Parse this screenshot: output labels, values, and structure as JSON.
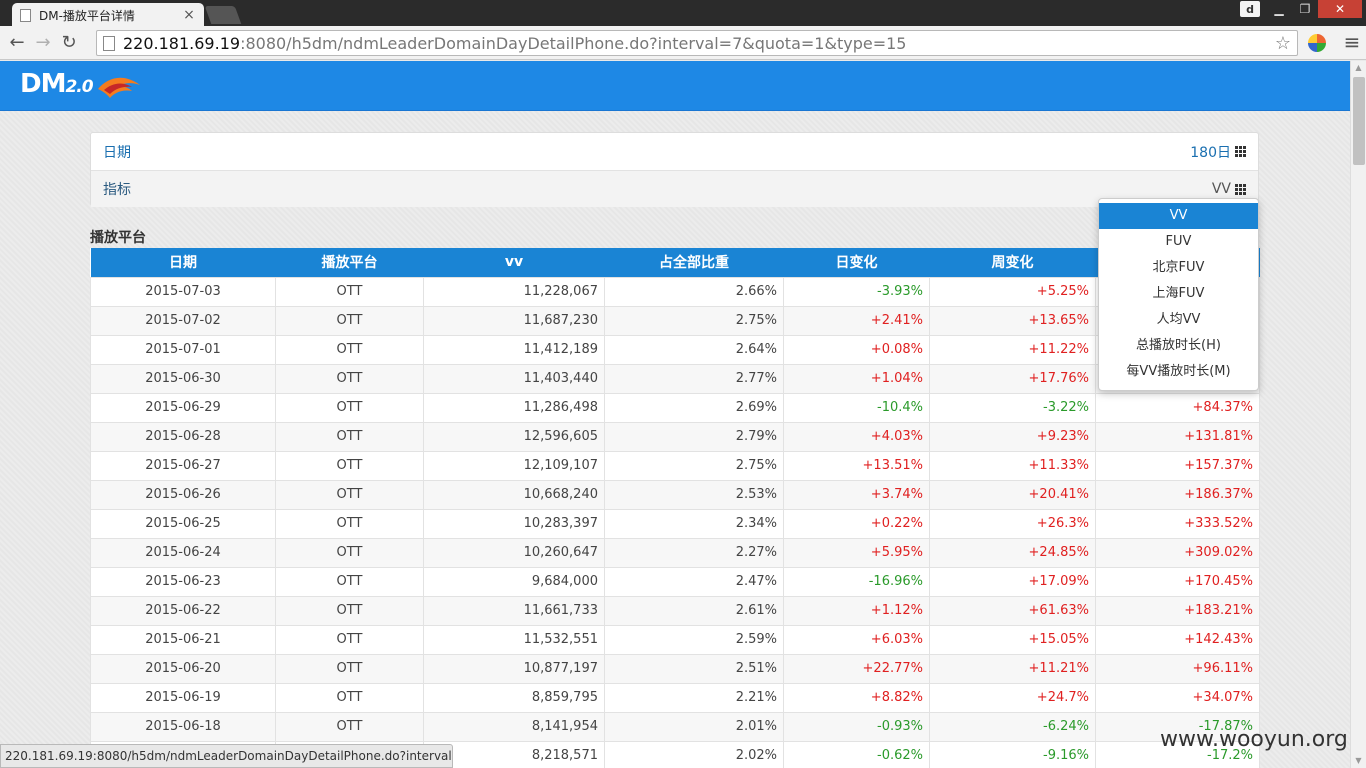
{
  "browser": {
    "tab_title": "DM-播放平台详情",
    "user_badge": "d",
    "url_host": "220.181.69.19",
    "url_path": ":8080/h5dm/ndmLeaderDomainDayDetailPhone.do?interval=7&quota=1&type=15"
  },
  "app": {
    "logo_text": "DM",
    "logo_version": "2.0"
  },
  "filters": {
    "date_label": "日期",
    "date_value": "180日",
    "metric_label": "指标",
    "metric_value": "VV"
  },
  "section_title": "播放平台",
  "table": {
    "headers": [
      "日期",
      "播放平台",
      "vv",
      "占全部比重",
      "日变化",
      "周变化",
      ""
    ],
    "rows": [
      [
        "2015-07-03",
        "OTT",
        "11,228,067",
        "2.66%",
        "-3.93%",
        "+5.25%",
        ""
      ],
      [
        "2015-07-02",
        "OTT",
        "11,687,230",
        "2.75%",
        "+2.41%",
        "+13.65%",
        ""
      ],
      [
        "2015-07-01",
        "OTT",
        "11,412,189",
        "2.64%",
        "+0.08%",
        "+11.22%",
        ""
      ],
      [
        "2015-06-30",
        "OTT",
        "11,403,440",
        "2.77%",
        "+1.04%",
        "+17.76%",
        ""
      ],
      [
        "2015-06-29",
        "OTT",
        "11,286,498",
        "2.69%",
        "-10.4%",
        "-3.22%",
        "+84.37%"
      ],
      [
        "2015-06-28",
        "OTT",
        "12,596,605",
        "2.79%",
        "+4.03%",
        "+9.23%",
        "+131.81%"
      ],
      [
        "2015-06-27",
        "OTT",
        "12,109,107",
        "2.75%",
        "+13.51%",
        "+11.33%",
        "+157.37%"
      ],
      [
        "2015-06-26",
        "OTT",
        "10,668,240",
        "2.53%",
        "+3.74%",
        "+20.41%",
        "+186.37%"
      ],
      [
        "2015-06-25",
        "OTT",
        "10,283,397",
        "2.34%",
        "+0.22%",
        "+26.3%",
        "+333.52%"
      ],
      [
        "2015-06-24",
        "OTT",
        "10,260,647",
        "2.27%",
        "+5.95%",
        "+24.85%",
        "+309.02%"
      ],
      [
        "2015-06-23",
        "OTT",
        "9,684,000",
        "2.47%",
        "-16.96%",
        "+17.09%",
        "+170.45%"
      ],
      [
        "2015-06-22",
        "OTT",
        "11,661,733",
        "2.61%",
        "+1.12%",
        "+61.63%",
        "+183.21%"
      ],
      [
        "2015-06-21",
        "OTT",
        "11,532,551",
        "2.59%",
        "+6.03%",
        "+15.05%",
        "+142.43%"
      ],
      [
        "2015-06-20",
        "OTT",
        "10,877,197",
        "2.51%",
        "+22.77%",
        "+11.21%",
        "+96.11%"
      ],
      [
        "2015-06-19",
        "OTT",
        "8,859,795",
        "2.21%",
        "+8.82%",
        "+24.7%",
        "+34.07%"
      ],
      [
        "2015-06-18",
        "OTT",
        "8,141,954",
        "2.01%",
        "-0.93%",
        "-6.24%",
        "-17.87%"
      ],
      [
        "",
        "",
        "8,218,571",
        "2.02%",
        "-0.62%",
        "-9.16%",
        "-17.2%"
      ]
    ]
  },
  "dropdown": {
    "options": [
      "VV",
      "FUV",
      "北京FUV",
      "上海FUV",
      "人均VV",
      "总播放时长(H)",
      "每VV播放时长(M)"
    ],
    "selected_index": 0
  },
  "status_bar": {
    "url": "220.181.69.19:8080/h5dm/ndmLeaderDomainDayDetailPhone.do?interval=..."
  },
  "watermark": "www.wooyun.org",
  "colors": {
    "accent": "#1e88e5",
    "positive": "#e02020",
    "negative": "#2a9a2a"
  }
}
